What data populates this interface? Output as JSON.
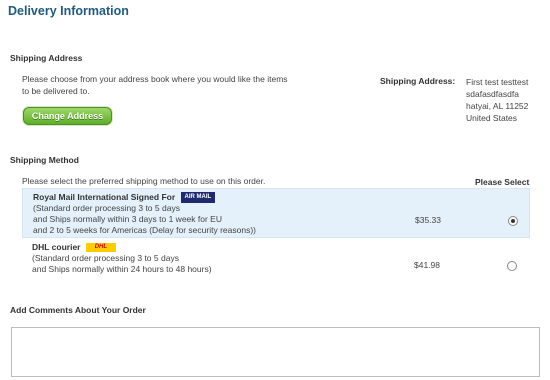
{
  "title": "Delivery Information",
  "shipping_address": {
    "heading": "Shipping Address",
    "intro": "Please choose from your address book where you would like the items to be delivered to.",
    "change_button": "Change Address",
    "label": "Shipping Address:",
    "lines": [
      "First test testtest",
      "sdafasdfasdfa",
      "hatyai, AL 11252",
      "United States"
    ]
  },
  "shipping_method": {
    "heading": "Shipping Method",
    "intro": "Please select the preferred shipping method to use on this order.",
    "please_select": "Please Select",
    "options": [
      {
        "name": "Royal Mail International Signed For",
        "badge": "AIR MAIL",
        "desc": [
          "(Standard order processing 3 to 5 days",
          "and Ships normally within 3 days to 1 week for EU",
          "and 2 to 5 weeks for Americas (Delay for security reasons))"
        ],
        "price": "$35.33",
        "selected": true
      },
      {
        "name": "DHL courier",
        "badge": "DHL",
        "desc": [
          "(Standard order processing 3 to 5 days",
          "and Ships normally within 24 hours to 48 hours)"
        ],
        "price": "$41.98",
        "selected": false
      }
    ]
  },
  "comments": {
    "heading": "Add Comments About Your Order",
    "value": ""
  },
  "colors": {
    "title": "#1f5a80",
    "button_green": "#6db33f",
    "selected_row": "#e4f1fa"
  }
}
